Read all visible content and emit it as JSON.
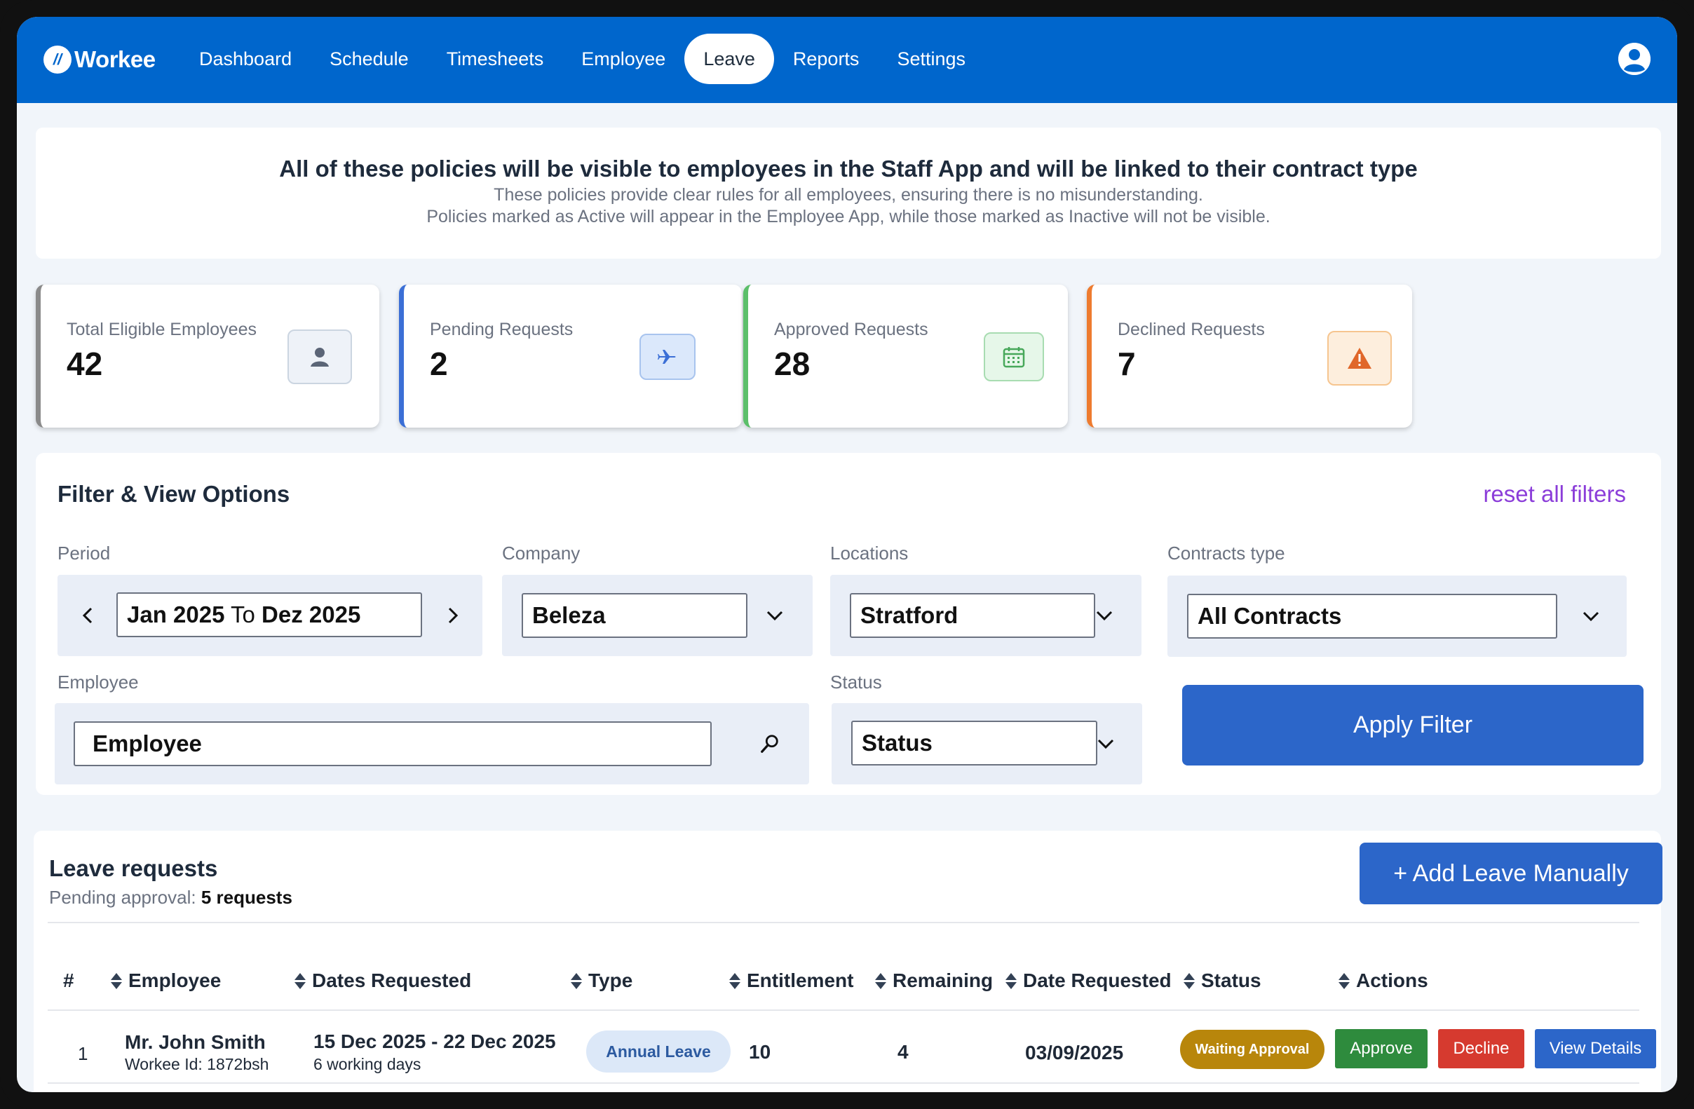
{
  "app": {
    "name": "Workee",
    "logo_glyph": "//"
  },
  "nav": {
    "items": [
      {
        "label": "Dashboard"
      },
      {
        "label": "Schedule"
      },
      {
        "label": "Timesheets"
      },
      {
        "label": "Employee"
      },
      {
        "label": "Leave",
        "active": true
      },
      {
        "label": "Reports"
      },
      {
        "label": "Settings"
      }
    ],
    "user_icon": "user-circle-icon"
  },
  "banner": {
    "title": "All of these policies will be visible to employees in the Staff App and will be linked to their contract type",
    "line1": "These policies provide clear rules for all employees, ensuring there is no misunderstanding.",
    "line2": "Policies marked as Active will appear in the Employee App, while those marked as Inactive will not be visible."
  },
  "stats": [
    {
      "label": "Total Eligible Employees",
      "value": "42",
      "icon": "user-icon",
      "accent": "#8a8a8a"
    },
    {
      "label": "Pending Requests",
      "value": "2",
      "icon": "plane-icon",
      "accent": "#3b6fd6"
    },
    {
      "label": "Approved Requests",
      "value": "28",
      "icon": "calendar-icon",
      "accent": "#5cbf6a"
    },
    {
      "label": "Declined Requests",
      "value": "7",
      "icon": "warning-icon",
      "accent": "#ee7b2f"
    }
  ],
  "filters": {
    "title": "Filter & View Options",
    "reset_label": "reset all filters",
    "period": {
      "label": "Period",
      "from": "Jan 2025",
      "joiner": " To ",
      "to": "Dez 2025"
    },
    "company": {
      "label": "Company",
      "value": "Beleza"
    },
    "locations": {
      "label": "Locations",
      "value": "Stratford"
    },
    "contracts": {
      "label": "Contracts type",
      "value": "All Contracts"
    },
    "employee": {
      "label": "Employee",
      "value": "Employee"
    },
    "status": {
      "label": "Status",
      "value": "Status"
    },
    "apply_label": "Apply Filter"
  },
  "requests": {
    "title": "Leave requests",
    "pending_prefix": "Pending approval:",
    "pending_count": "5 requests",
    "add_label": "+ Add Leave Manually",
    "columns": [
      "#",
      "Employee",
      "Dates Requested",
      "Type",
      "Entitlement",
      "Remaining",
      "Date Requested",
      "Status",
      "Actions"
    ],
    "rows": [
      {
        "index": "1",
        "name": "Mr. John Smith",
        "workee_id": "Workee Id: 1872bsh",
        "dates": "15 Dec 2025 - 22 Dec 2025",
        "days": "6 working days",
        "type": "Annual Leave",
        "entitlement": "10",
        "remaining": "4",
        "date_requested": "03/09/2025",
        "status": "Waiting Approval",
        "actions": {
          "approve": "Approve",
          "decline": "Decline",
          "view": "View Details"
        }
      }
    ]
  },
  "colors": {
    "nav_bg": "#0066cc",
    "primary_button": "#2c66c9",
    "approve": "#2e8b3d",
    "decline": "#d63a2f",
    "view": "#2c66c9",
    "waiting_badge": "#b8860b",
    "reset_link": "#8b3dd9"
  }
}
